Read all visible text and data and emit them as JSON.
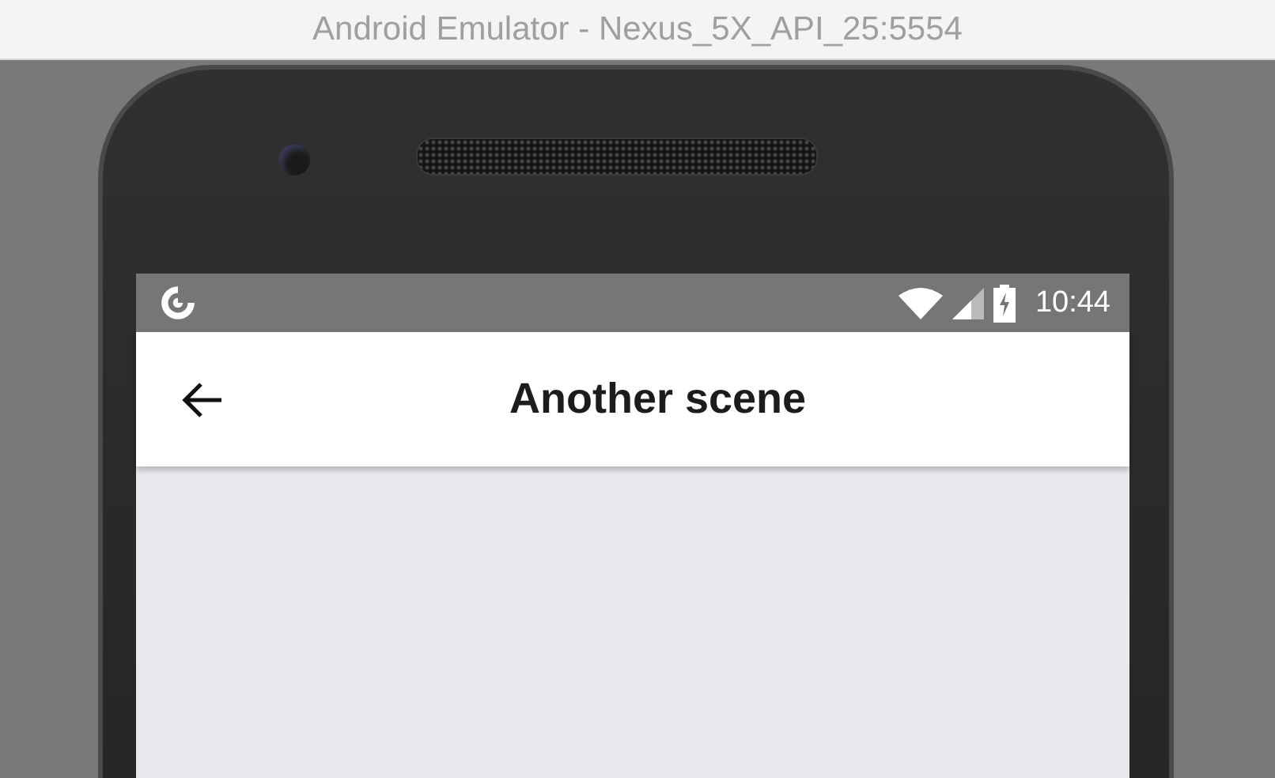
{
  "window": {
    "title": "Android Emulator - Nexus_5X_API_25:5554"
  },
  "status_bar": {
    "time": "10:44"
  },
  "app_bar": {
    "title": "Another scene"
  }
}
